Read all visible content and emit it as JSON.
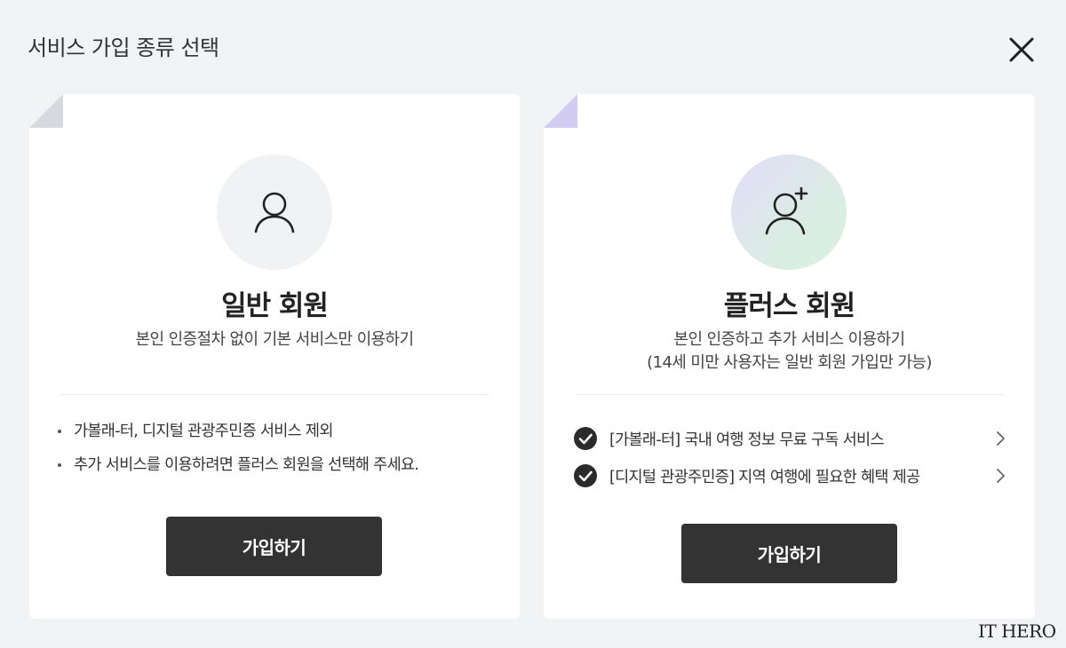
{
  "header": {
    "title": "서비스 가입 종류 선택"
  },
  "icons": {
    "close": "close-icon",
    "basic_avatar": "user-icon",
    "plus_avatar": "user-plus-icon",
    "check": "check-circle-icon",
    "chevron": "chevron-right-icon"
  },
  "colors": {
    "button": "#333333",
    "page_bg": "#f2f3f5",
    "basic_corner": "#d6d9de",
    "plus_corner": "#d3ccf2"
  },
  "cards": {
    "basic": {
      "title": "일반 회원",
      "subtitle": "본인 인증절차 없이 기본 서비스만 이용하기",
      "notes": [
        "가볼래-터, 디지털 관광주민증 서비스 제외",
        "추가 서비스를 이용하려면 플러스 회원을 선택해 주세요."
      ],
      "button_label": "가입하기"
    },
    "plus": {
      "title": "플러스 회원",
      "subtitle_line1": "본인 인증하고 추가 서비스 이용하기",
      "subtitle_line2": "(14세 미만 사용자는 일반 회원 가입만 가능)",
      "features": [
        "[가볼래-터] 국내 여행 정보 무료 구독 서비스",
        "[디지털 관광주민증] 지역 여행에 필요한 혜택 제공"
      ],
      "button_label": "가입하기"
    }
  },
  "watermark": "IT HERO"
}
